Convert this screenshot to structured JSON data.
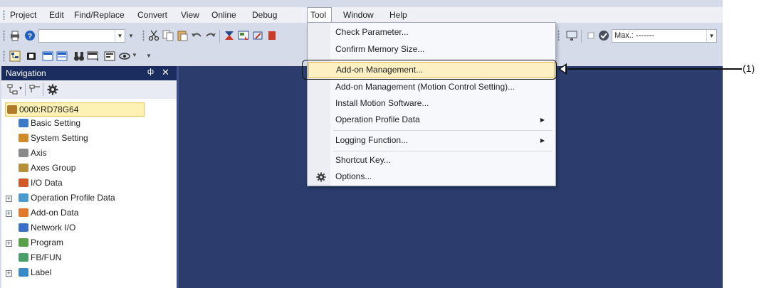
{
  "menubar": {
    "items": [
      "Project",
      "Edit",
      "Find/Replace",
      "Convert",
      "View",
      "Online",
      "Debug",
      "Tool",
      "Window",
      "Help"
    ],
    "open_item": "Tool"
  },
  "toolbar": {
    "combo_value": "",
    "max_combo_value": "Max.: -------"
  },
  "navigation": {
    "title": "Navigation",
    "pin_glyph": "ф",
    "close_glyph": "✕",
    "tree": [
      {
        "label": "0000:RD78G64",
        "icon": "module-icon",
        "color": "#b07a2a"
      },
      {
        "label": "Basic Setting",
        "icon": "basic-setting-icon",
        "color": "#3c78c8"
      },
      {
        "label": "System Setting",
        "icon": "system-setting-icon",
        "color": "#d08a28"
      },
      {
        "label": "Axis",
        "icon": "axis-icon",
        "color": "#8a8a8a"
      },
      {
        "label": "Axes Group",
        "icon": "axes-group-icon",
        "color": "#b58f3a"
      },
      {
        "label": "I/O Data",
        "icon": "io-data-icon",
        "color": "#d05a2a"
      },
      {
        "label": "Operation Profile Data",
        "icon": "operation-profile-icon",
        "color": "#4a9ad0",
        "expander": "+"
      },
      {
        "label": "Add-on Data",
        "icon": "add-on-data-icon",
        "color": "#e07a2a",
        "expander": "+"
      },
      {
        "label": "Network I/O",
        "icon": "network-io-icon",
        "color": "#3a6fc8"
      },
      {
        "label": "Program",
        "icon": "program-icon",
        "color": "#5aa04a",
        "expander": "+"
      },
      {
        "label": "FB/FUN",
        "icon": "fb-fun-icon",
        "color": "#4aa06a"
      },
      {
        "label": "Label",
        "icon": "label-icon",
        "color": "#3a8ac8",
        "expander": "+"
      }
    ]
  },
  "tool_menu": {
    "items": [
      {
        "label": "Check Parameter...",
        "submenu": false
      },
      {
        "label": "Confirm Memory Size...",
        "submenu": false
      },
      {
        "label": "Add-on Management...",
        "submenu": false,
        "highlighted": true
      },
      {
        "label": "Add-on Management (Motion Control Setting)...",
        "submenu": false
      },
      {
        "label": "Install Motion Software...",
        "submenu": false
      },
      {
        "label": "Operation Profile Data",
        "submenu": true
      },
      {
        "label": "Logging Function...",
        "submenu": true
      },
      {
        "label": "Shortcut Key...",
        "submenu": false
      },
      {
        "label": "Options...",
        "submenu": false,
        "icon": "gear-icon"
      }
    ],
    "submenu_arrow": "▶"
  },
  "callout": {
    "label": "(1)"
  },
  "colors": {
    "nav_header": "#1b2d5e",
    "work_area": "#2b3c6d",
    "menu_highlight": "#fdf0c2",
    "selection": "#fdf2b3"
  }
}
